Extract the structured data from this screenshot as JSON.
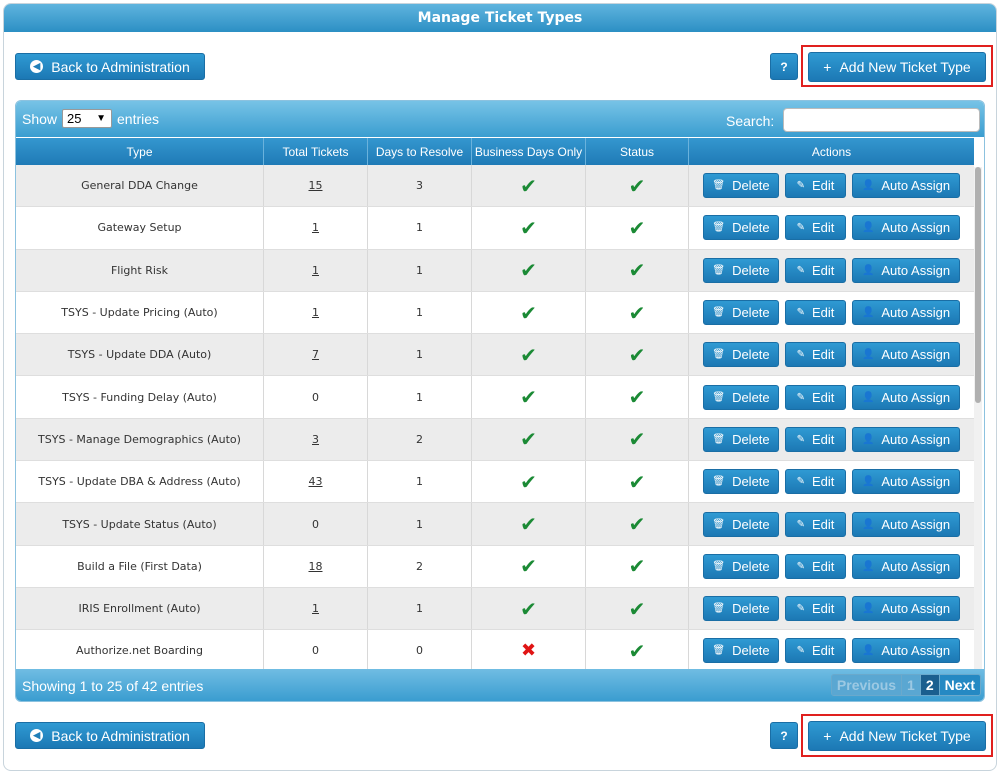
{
  "title": "Manage Ticket Types",
  "back_label": "Back to Administration",
  "help_label": "?",
  "add_label": "Add New Ticket Type",
  "table": {
    "show_label": "Show",
    "page_length": "25",
    "entries_label": "entries",
    "search_label": "Search:",
    "search_value": "",
    "columns": [
      "Type",
      "Total Tickets",
      "Days to Resolve",
      "Business Days Only",
      "Status",
      "Actions"
    ],
    "rows": [
      {
        "type": "General DDA Change",
        "total": "15",
        "days": "3",
        "business_days": true,
        "status": true
      },
      {
        "type": "Gateway Setup",
        "total": "1",
        "days": "1",
        "business_days": true,
        "status": true
      },
      {
        "type": "Flight Risk",
        "total": "1",
        "days": "1",
        "business_days": true,
        "status": true
      },
      {
        "type": "TSYS - Update Pricing (Auto)",
        "total": "1",
        "days": "1",
        "business_days": true,
        "status": true
      },
      {
        "type": "TSYS - Update DDA (Auto)",
        "total": "7",
        "days": "1",
        "business_days": true,
        "status": true
      },
      {
        "type": "TSYS - Funding Delay (Auto)",
        "total": "0",
        "days": "1",
        "business_days": true,
        "status": true
      },
      {
        "type": "TSYS - Manage Demographics (Auto)",
        "total": "3",
        "days": "2",
        "business_days": true,
        "status": true
      },
      {
        "type": "TSYS - Update DBA & Address (Auto)",
        "total": "43",
        "days": "1",
        "business_days": true,
        "status": true
      },
      {
        "type": "TSYS - Update Status (Auto)",
        "total": "0",
        "days": "1",
        "business_days": true,
        "status": true
      },
      {
        "type": "Build a File (First Data)",
        "total": "18",
        "days": "2",
        "business_days": true,
        "status": true
      },
      {
        "type": "IRIS Enrollment (Auto)",
        "total": "1",
        "days": "1",
        "business_days": true,
        "status": true
      },
      {
        "type": "Authorize.net Boarding",
        "total": "0",
        "days": "0",
        "business_days": false,
        "status": true
      }
    ],
    "actions": {
      "delete": "Delete",
      "edit": "Edit",
      "auto_assign": "Auto Assign"
    },
    "info": "Showing 1 to 25 of 42 entries",
    "pager": {
      "previous": "Previous",
      "pages": [
        "1",
        "2"
      ],
      "current": "2",
      "next": "Next"
    }
  },
  "colors": {
    "accent": "#1f80bb",
    "header_light": "#5fb4de",
    "check": "#1b8a35",
    "cross": "#e01414",
    "highlight": "#e0201e"
  }
}
